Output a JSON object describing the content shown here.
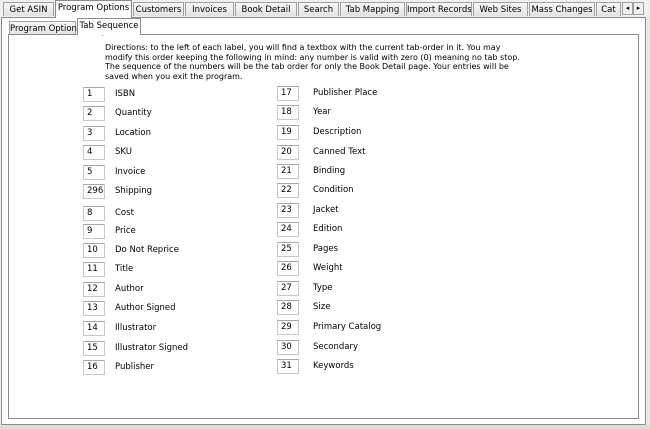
{
  "top_tabs": [
    {
      "label": "Get ASIN"
    },
    {
      "label": "Program Options"
    },
    {
      "label": "Customers"
    },
    {
      "label": "Invoices"
    },
    {
      "label": "Book Detail"
    },
    {
      "label": "Search"
    },
    {
      "label": "Tab Mapping"
    },
    {
      "label": "Import Records"
    },
    {
      "label": "Web Sites"
    },
    {
      "label": "Mass Changes"
    },
    {
      "label": "Cat"
    }
  ],
  "scroll_left": "◂",
  "scroll_right": "▸",
  "inner_tabs": [
    {
      "label": "Program Options"
    },
    {
      "label": "Tab Sequence"
    }
  ],
  "directions": "Directions:  to the left of each label, you will find a textbox with the current tab-order in it.  You may modify this order keeping the following in mind: any number is valid with zero (0) meaning no tab stop.  The sequence of the numbers will be the tab order for only the Book Detail page.  Your entries will be saved when you exit the program.",
  "left_fields": [
    {
      "value": "1",
      "label": "ISBN"
    },
    {
      "value": "2",
      "label": "Quantity"
    },
    {
      "value": "3",
      "label": "Location"
    },
    {
      "value": "4",
      "label": "SKU"
    },
    {
      "value": "5",
      "label": "Invoice"
    },
    {
      "value": "296",
      "label": "Shipping"
    },
    {
      "value": "8",
      "label": "Cost"
    },
    {
      "value": "9",
      "label": "Price"
    },
    {
      "value": "10",
      "label": "Do Not Reprice"
    },
    {
      "value": "11",
      "label": "Title"
    },
    {
      "value": "12",
      "label": "Author"
    },
    {
      "value": "13",
      "label": "Author Signed"
    },
    {
      "value": "14",
      "label": "Illustrator"
    },
    {
      "value": "15",
      "label": "Illustrator Signed"
    },
    {
      "value": "16",
      "label": "Publisher"
    }
  ],
  "right_fields": [
    {
      "value": "17",
      "label": "Publisher Place"
    },
    {
      "value": "18",
      "label": "Year"
    },
    {
      "value": "19",
      "label": "Description"
    },
    {
      "value": "20",
      "label": "Canned Text"
    },
    {
      "value": "21",
      "label": "Binding"
    },
    {
      "value": "22",
      "label": "Condition"
    },
    {
      "value": "23",
      "label": "Jacket"
    },
    {
      "value": "24",
      "label": "Edition"
    },
    {
      "value": "25",
      "label": "Pages"
    },
    {
      "value": "26",
      "label": "Weight"
    },
    {
      "value": "27",
      "label": "Type"
    },
    {
      "value": "28",
      "label": "Size"
    },
    {
      "value": "29",
      "label": "Primary Catalog"
    },
    {
      "value": "30",
      "label": "Secondary"
    },
    {
      "value": "31",
      "label": "Keywords"
    }
  ]
}
